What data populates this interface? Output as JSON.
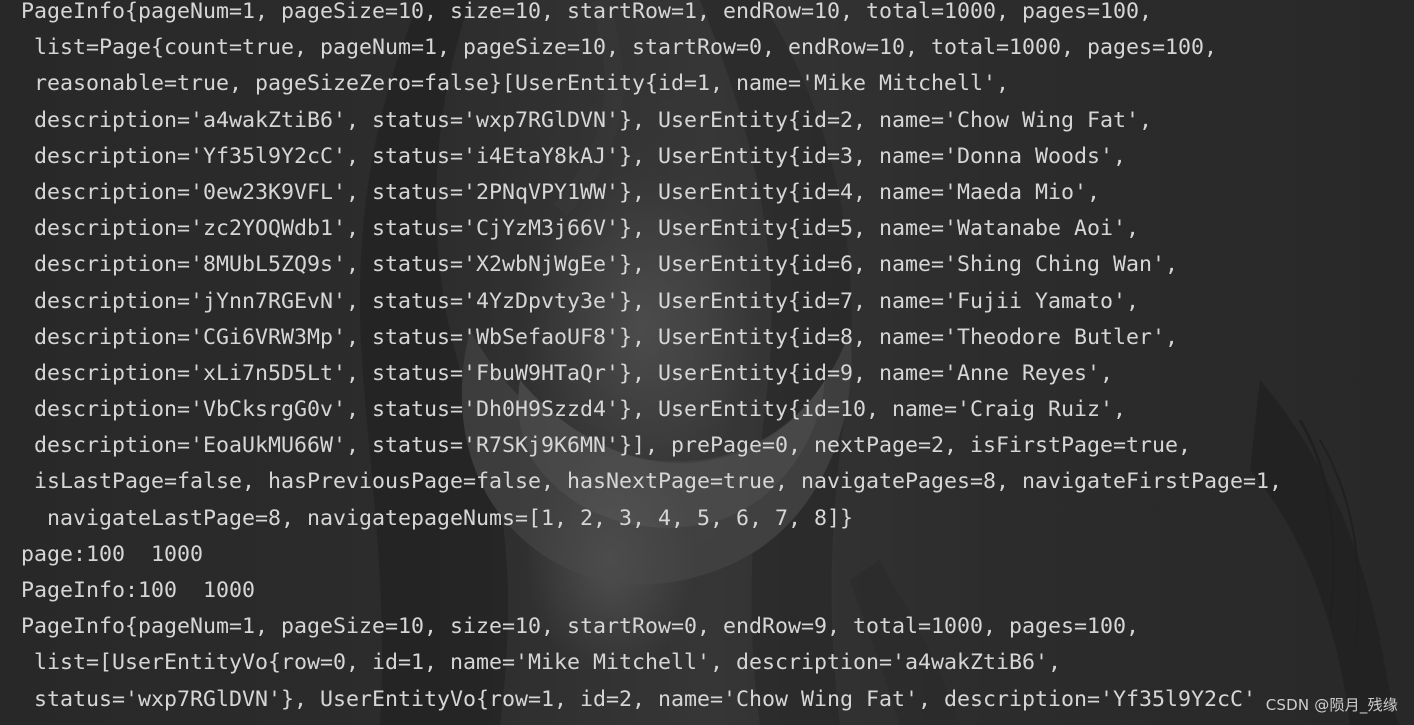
{
  "console": {
    "lines": [
      "PageInfo{pageNum=1, pageSize=10, size=10, startRow=1, endRow=10, total=1000, pages=100,",
      " list=Page{count=true, pageNum=1, pageSize=10, startRow=0, endRow=10, total=1000, pages=100,",
      " reasonable=true, pageSizeZero=false}[UserEntity{id=1, name='Mike Mitchell',",
      " description='a4wakZtiB6', status='wxp7RGlDVN'}, UserEntity{id=2, name='Chow Wing Fat',",
      " description='Yf35l9Y2cC', status='i4EtaY8kAJ'}, UserEntity{id=3, name='Donna Woods',",
      " description='0ew23K9VFL', status='2PNqVPY1WW'}, UserEntity{id=4, name='Maeda Mio',",
      " description='zc2YOQWdb1', status='CjYzM3j66V'}, UserEntity{id=5, name='Watanabe Aoi',",
      " description='8MUbL5ZQ9s', status='X2wbNjWgEe'}, UserEntity{id=6, name='Shing Ching Wan',",
      " description='jYnn7RGEvN', status='4YzDpvty3e'}, UserEntity{id=7, name='Fujii Yamato',",
      " description='CGi6VRW3Mp', status='WbSefaoUF8'}, UserEntity{id=8, name='Theodore Butler',",
      " description='xLi7n5D5Lt', status='FbuW9HTaQr'}, UserEntity{id=9, name='Anne Reyes',",
      " description='VbCksrgG0v', status='Dh0H9Szzd4'}, UserEntity{id=10, name='Craig Ruiz',",
      " description='EoaUkMU66W', status='R7SKj9K6MN'}], prePage=0, nextPage=2, isFirstPage=true,",
      " isLastPage=false, hasPreviousPage=false, hasNextPage=true, navigatePages=8, navigateFirstPage=1,",
      "  navigateLastPage=8, navigatepageNums=[1, 2, 3, 4, 5, 6, 7, 8]}",
      "page:100  1000",
      "PageInfo:100  1000",
      "PageInfo{pageNum=1, pageSize=10, size=10, startRow=0, endRow=9, total=1000, pages=100,",
      " list=[UserEntityVo{row=0, id=1, name='Mike Mitchell', description='a4wakZtiB6',",
      " status='wxp7RGlDVN'}, UserEntityVo{row=1, id=2, name='Chow Wing Fat', description='Yf35l9Y2cC'"
    ]
  },
  "watermark": "CSDN @陨月_残缘",
  "colors": {
    "background": "#2b2b2b",
    "text": "#d6d6d6"
  }
}
